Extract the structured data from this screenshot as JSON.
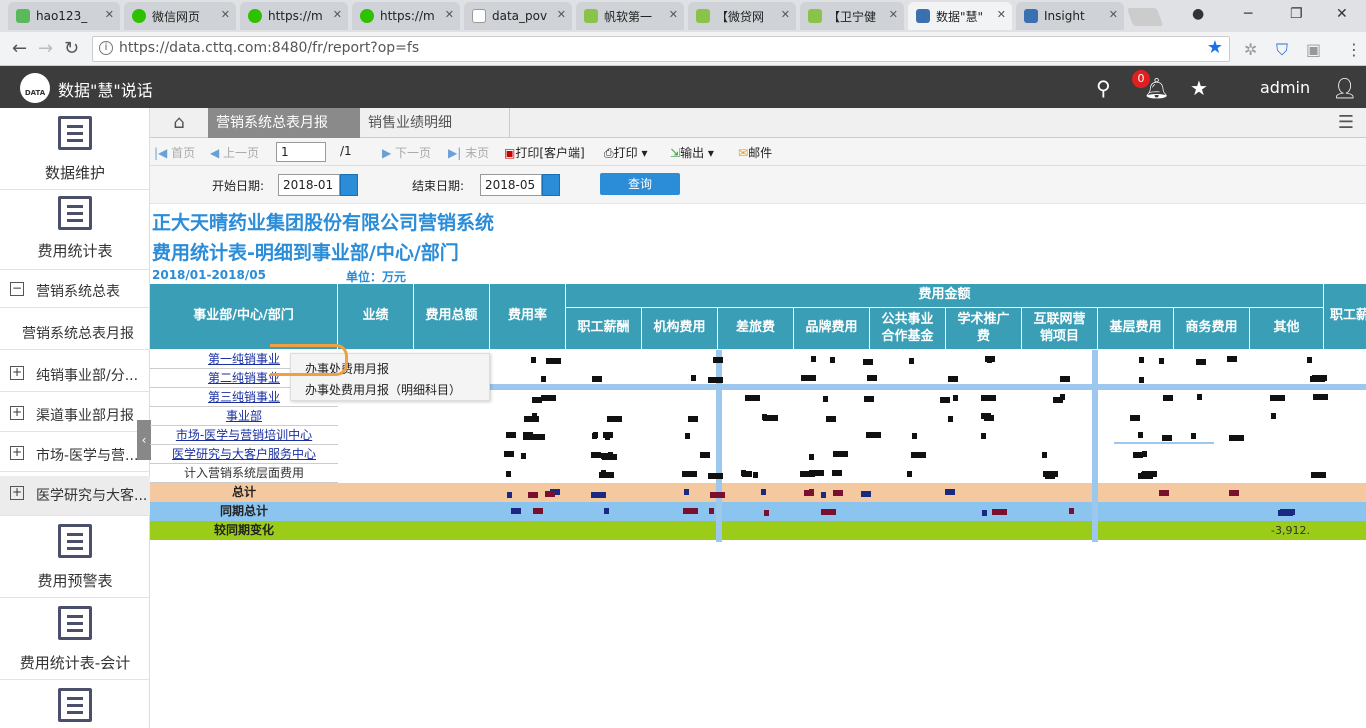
{
  "browser": {
    "tabs": [
      {
        "label": "hao123_",
        "color": "#5cb85c"
      },
      {
        "label": "微信网页",
        "color": "#2dc100"
      },
      {
        "label": "https://m",
        "color": "#2dc100"
      },
      {
        "label": "https://m",
        "color": "#2dc100"
      },
      {
        "label": "data_pov",
        "color": "#999999"
      },
      {
        "label": "帆软第一",
        "color": "#8bc34a"
      },
      {
        "label": "【微贷网",
        "color": "#8bc34a"
      },
      {
        "label": "【卫宁健",
        "color": "#8bc34a"
      },
      {
        "label": "数据\"慧\"",
        "color": "#3a6fb0"
      },
      {
        "label": "Insight",
        "color": "#3a6fb0"
      }
    ],
    "url": "https://data.cttq.com:8480/fr/report?op=fs"
  },
  "app": {
    "name": "数据\"慧\"说话",
    "logo_text": "DATA",
    "notification_count": "0",
    "user": "admin"
  },
  "sidebar": {
    "big_items": [
      "数据维护",
      "费用统计表",
      "费用预警表",
      "费用统计表-会计"
    ],
    "rows": [
      {
        "label": "营销系统总表",
        "icon": "−"
      },
      {
        "label": "营销系统总表月报",
        "icon": ""
      },
      {
        "label": "纯销事业部/分...",
        "icon": "+"
      },
      {
        "label": "渠道事业部月报",
        "icon": "+"
      },
      {
        "label": "市场-医学与营...",
        "icon": "+"
      },
      {
        "label": "医学研究与大客...",
        "icon": "+"
      }
    ]
  },
  "report_tabs": [
    "营销系统总表月报",
    "销售业绩明细"
  ],
  "toolbar": {
    "first": "首页",
    "prev": "上一页",
    "page": "1",
    "total": "/1",
    "next": "下一页",
    "last": "末页",
    "print_client": "打印[客户端]",
    "print": "打印",
    "export": "输出",
    "mail": "邮件"
  },
  "params": {
    "start_label": "开始日期:",
    "start_value": "2018-01",
    "end_label": "结束日期:",
    "end_value": "2018-05",
    "query": "查询"
  },
  "report": {
    "title1": "正大天晴药业集团股份有限公司营销系统",
    "title2": "费用统计表-明细到事业部/中心/部门",
    "period": "2018/01-2018/05",
    "unit": "单位：万元",
    "headers": {
      "dept": "事业部/中心/部门",
      "perf": "业绩",
      "total": "费用总额",
      "rate": "费用率",
      "group": "费用金额",
      "cols": [
        "职工薪酬",
        "机构费用",
        "差旅费",
        "品牌费用",
        "公共事业\n合作基金",
        "学术推广\n费",
        "互联网营\n销项目",
        "基层费用",
        "商务费用",
        "其他",
        "职工薪"
      ]
    },
    "rows": [
      {
        "label": "第一纯销事业",
        "link": true
      },
      {
        "label": "第二纯销事业",
        "link": true
      },
      {
        "label": "第三纯销事业",
        "link": true
      },
      {
        "label": "事业部",
        "link": true
      },
      {
        "label": "市场-医学与营销培训中心",
        "link": true
      },
      {
        "label": "医学研究与大客户服务中心",
        "link": true
      },
      {
        "label": "计入营销系统层面费用",
        "link": false
      }
    ],
    "summary": [
      {
        "label": "总计",
        "color": "#f5c9a0"
      },
      {
        "label": "同期总计",
        "color": "#8cc4f0"
      },
      {
        "label": "较同期变化",
        "color": "#9ccc1a"
      }
    ],
    "visible_values": [
      "-3,912."
    ]
  },
  "popup": [
    "办事处费用月报",
    "办事处费用月报（明细科目）"
  ]
}
